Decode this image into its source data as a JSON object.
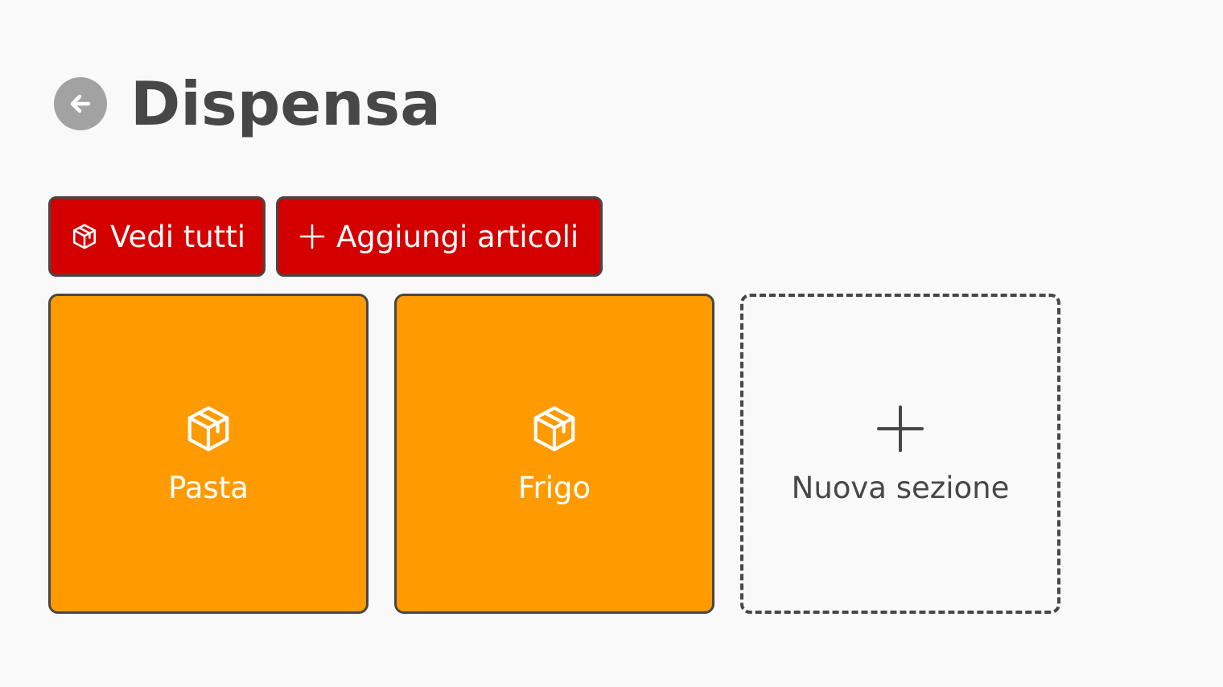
{
  "header": {
    "title": "Dispensa",
    "back_icon": "arrow-left-icon"
  },
  "toolbar": {
    "view_all": {
      "label": "Vedi tutti",
      "icon": "package-icon"
    },
    "add_items": {
      "label": "Aggiungi articoli",
      "icon": "plus-icon"
    }
  },
  "sections": [
    {
      "label": "Pasta",
      "icon": "package-icon"
    },
    {
      "label": "Frigo",
      "icon": "package-icon"
    }
  ],
  "new_section": {
    "label": "Nuova sezione",
    "icon": "plus-icon"
  },
  "colors": {
    "background": "#f9f9f9",
    "text": "#474747",
    "button_red": "#d40000",
    "tile_orange": "#ff9b00",
    "back_button": "#a2a2a2"
  }
}
